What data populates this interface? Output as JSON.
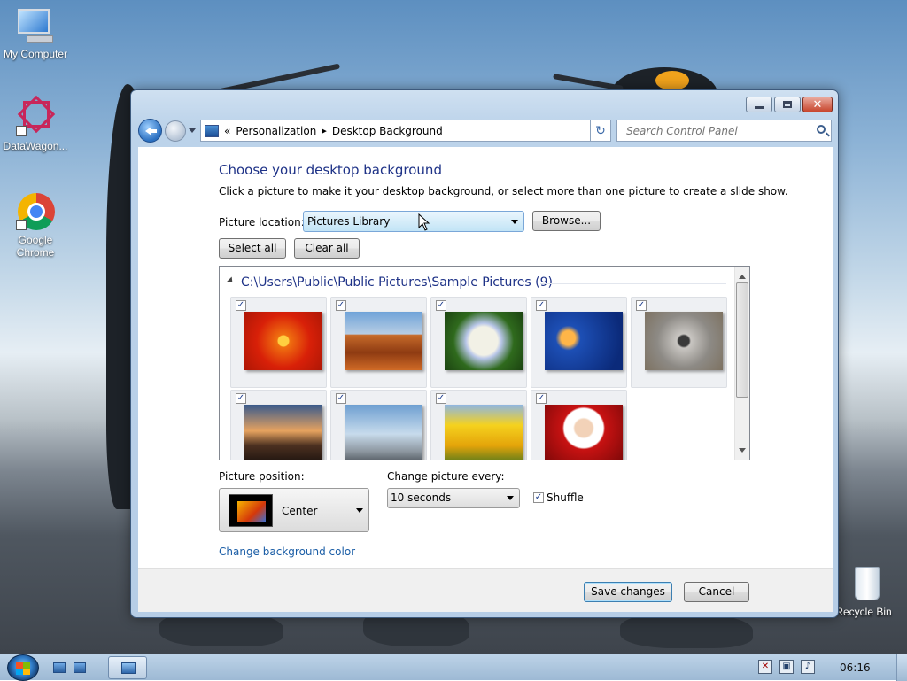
{
  "desktop": {
    "icons": [
      {
        "label": "My Computer"
      },
      {
        "label": "DataWagon..."
      },
      {
        "label": "Google Chrome"
      },
      {
        "label": "Recycle Bin"
      }
    ]
  },
  "window": {
    "address": {
      "chevron": "«",
      "crumbs": [
        "Personalization",
        "Desktop Background"
      ],
      "separator": "▸"
    },
    "search": {
      "placeholder": "Search Control Panel"
    },
    "heading": "Choose your desktop background",
    "subtext": "Click a picture to make it your desktop background, or select more than one picture to create a slide show.",
    "picture_location": {
      "label": "Picture location:",
      "value": "Pictures Library"
    },
    "browse_label": "Browse...",
    "select_all_label": "Select all",
    "clear_all_label": "Clear all",
    "gallery": {
      "group_title": "C:\\Users\\Public\\Public Pictures\\Sample Pictures (9)",
      "pictures": [
        {
          "name": "Chrysanthemum",
          "checked": true
        },
        {
          "name": "Desert",
          "checked": true
        },
        {
          "name": "Hydrangeas",
          "checked": true
        },
        {
          "name": "Jellyfish",
          "checked": true
        },
        {
          "name": "Koala",
          "checked": true
        },
        {
          "name": "Lighthouse",
          "checked": true
        },
        {
          "name": "Penguins",
          "checked": true
        },
        {
          "name": "Tulips",
          "checked": true
        },
        {
          "name": "Santa",
          "checked": true
        }
      ]
    },
    "picture_position": {
      "label": "Picture position:",
      "value": "Center"
    },
    "change_every": {
      "label": "Change picture every:",
      "value": "10 seconds"
    },
    "shuffle": {
      "label": "Shuffle",
      "checked": true
    },
    "change_bg_color_link": "Change background color",
    "save_label": "Save changes",
    "cancel_label": "Cancel"
  },
  "taskbar": {
    "clock": "06:16"
  },
  "colors": {
    "heading_blue": "#1e3287",
    "link_blue": "#1a5da6"
  }
}
